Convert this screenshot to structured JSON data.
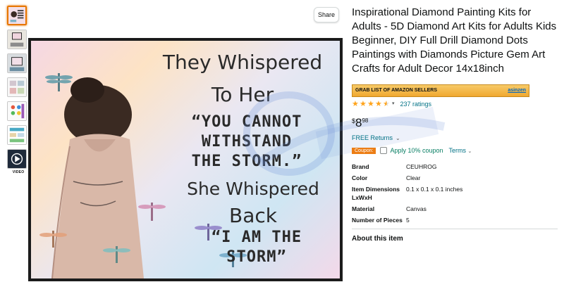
{
  "toolbar": {
    "share_label": "Share"
  },
  "thumbnails": {
    "video_label": "VIDEO",
    "count": 7,
    "icons": [
      "poster-thumbnail",
      "room-thumbnail",
      "wall-thumbnail",
      "kit-contents-thumbnail",
      "diamonds-thumbnail",
      "steps-thumbnail",
      "video-play-icon"
    ]
  },
  "poster": {
    "line1": "They Whispered",
    "line2": "To Her",
    "line3a": "“YOU CANNOT",
    "line3b": "WITHSTAND",
    "line3c": "THE STORM.”",
    "line4": "She Whispered",
    "line5": "Back",
    "line6a": "“I AM THE",
    "line6b": "STORM”"
  },
  "product": {
    "title": "Inspirational Diamond Painting Kits for Adults - 5D Diamond Art Kits for Adults Kids Beginner, DIY Full Drill Diamond Dots Paintings with Diamonds Picture Gem Art Crafts for Adult Decor 14x18inch",
    "seller_bar_label": "GRAB LIST OF AMAZON SELLERS",
    "seller_bar_link": "asinzen",
    "rating_value": 4.5,
    "ratings_count": "237 ratings",
    "price_symbol": "$",
    "price_whole": "8",
    "price_fraction": "98",
    "returns_label": "FREE Returns",
    "coupon_badge": "Coupon:",
    "coupon_text": "Apply 10% coupon",
    "terms_label": "Terms",
    "details": [
      {
        "key": "Brand",
        "value": "CEUHROG"
      },
      {
        "key": "Color",
        "value": "Clear"
      },
      {
        "key": "Item Dimensions LxWxH",
        "value": "0.1 x 0.1 x 0.1 inches"
      },
      {
        "key": "Material",
        "value": "Canvas"
      },
      {
        "key": "Number of Pieces",
        "value": "5"
      }
    ],
    "about_heading": "About this item"
  },
  "colors": {
    "accent_orange": "#e77600",
    "link_teal": "#007185",
    "coupon_green": "#067d62",
    "star_gold": "#ffa41c",
    "coupon_badge": "#ec7d15"
  }
}
